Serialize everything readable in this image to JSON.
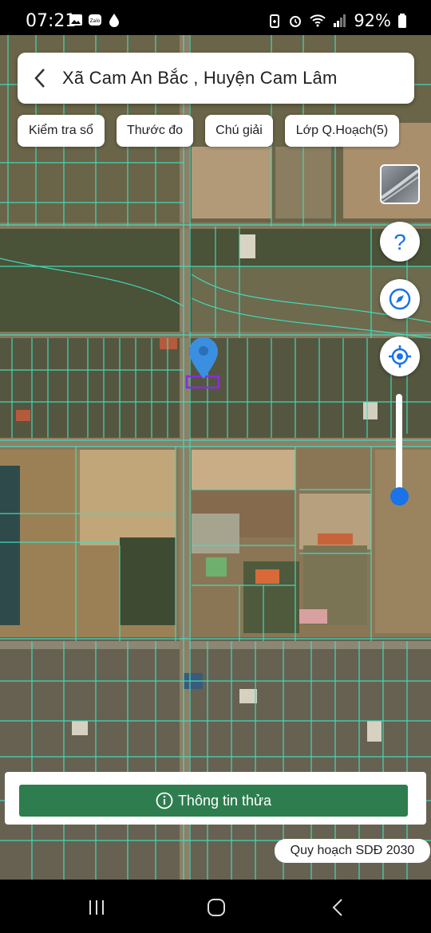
{
  "status_bar": {
    "time": "07:21",
    "battery": "92%",
    "left_icons": [
      "image-icon",
      "zalo-icon",
      "drop-icon"
    ],
    "right_icons": [
      "battery-saver-icon",
      "alarm-icon",
      "wifi-icon",
      "signal-icon",
      "battery-icon"
    ]
  },
  "header": {
    "title": "Xã Cam An Bắc , Huyện Cam Lâm",
    "back_icon": "chevron-left-icon"
  },
  "toolbar": {
    "check_book": "Kiểm tra sổ",
    "measure": "Thước đo",
    "legend": "Chú giải",
    "planning_layer": "Lớp Q.Hoạch(5)"
  },
  "controls": {
    "layer_thumb_icon": "satellite-layer-icon",
    "help_icon": "question-icon",
    "compass_icon": "compass-icon",
    "locate_icon": "locate-icon",
    "opacity_level": 0.1
  },
  "bottom": {
    "info_button": "Thông tin thửa",
    "info_icon": "info-icon",
    "plan_badge": "Quy hoạch SDĐ 2030"
  },
  "colors": {
    "parcel_line": "#3fe0c0",
    "info_button": "#2e7d4f",
    "marker": "#3b8fe0",
    "accent": "#1a73e8"
  }
}
